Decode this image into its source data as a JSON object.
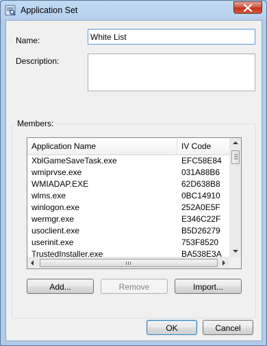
{
  "window": {
    "title": "Application Set",
    "app_icon": "application-set-icon",
    "close_icon": "close-x-icon"
  },
  "form": {
    "name_label": "Name:",
    "name_value": "White List",
    "description_label": "Description:",
    "description_value": ""
  },
  "members": {
    "group_label": "Members:",
    "columns": [
      "Application Name",
      "IV Code"
    ],
    "rows": [
      {
        "name": "XblGameSaveTask.exe",
        "code": "EFC58E84"
      },
      {
        "name": "wmiprvse.exe",
        "code": "031A88B6"
      },
      {
        "name": "WMIADAP.EXE",
        "code": "62D638B8"
      },
      {
        "name": "wlms.exe",
        "code": "0BC14910"
      },
      {
        "name": "winlogon.exe",
        "code": "252A0E5F"
      },
      {
        "name": "wermgr.exe",
        "code": "E346C22F"
      },
      {
        "name": "usoclient.exe",
        "code": "B5D26279"
      },
      {
        "name": "userinit.exe",
        "code": "753F8520"
      },
      {
        "name": "TrustedInstaller.exe",
        "code": "BA538E3A"
      }
    ],
    "add_label": "Add...",
    "remove_label": "Remove",
    "import_label": "Import..."
  },
  "footer": {
    "ok_label": "OK",
    "cancel_label": "Cancel"
  },
  "colors": {
    "title_bar": "#b6d0ec",
    "close_button": "#c2321b",
    "dialog_bg": "#f0f0f0",
    "focus_border": "#5a9bd8"
  }
}
